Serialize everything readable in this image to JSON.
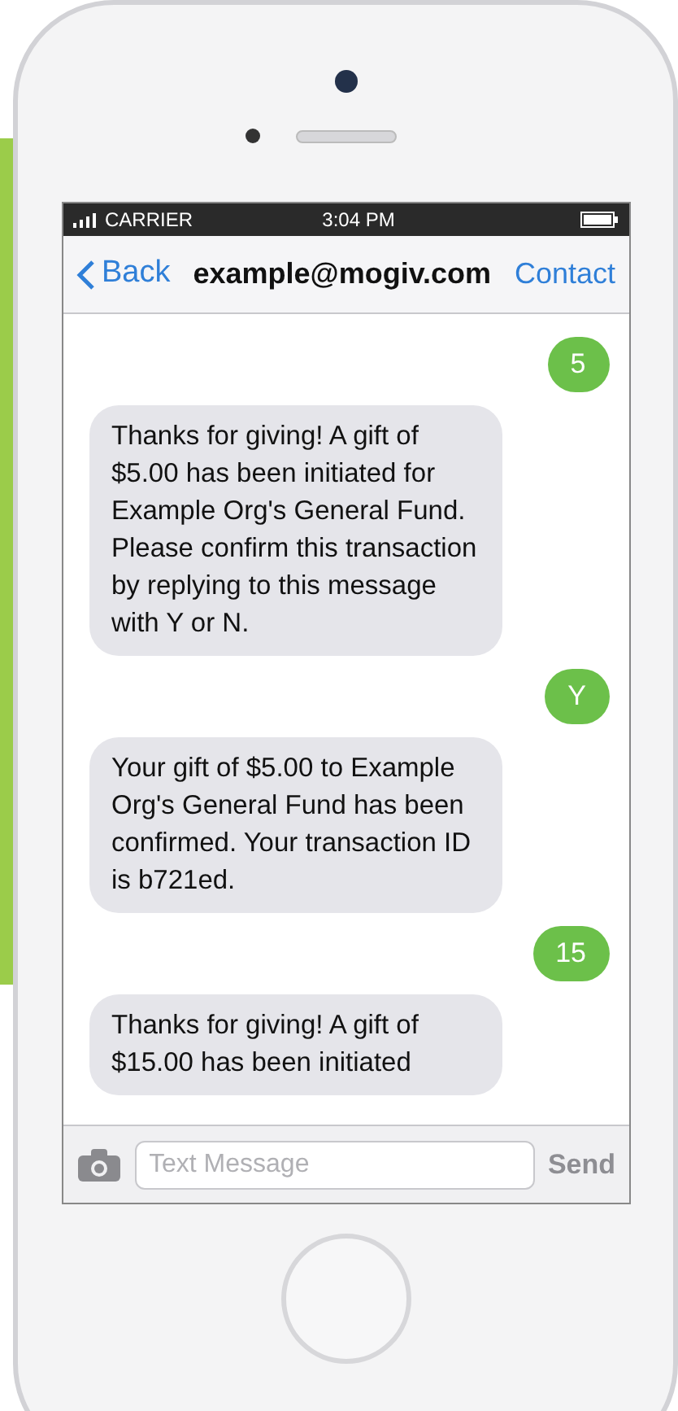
{
  "status_bar": {
    "carrier": "CARRIER",
    "time": "3:04 PM"
  },
  "nav_bar": {
    "back": "Back",
    "title": "example@mogiv.com",
    "action": "Contact"
  },
  "messages": [
    {
      "kind": "sent",
      "text": "5"
    },
    {
      "kind": "received",
      "text": "Thanks for giving! A gift of $5.00 has been initiated for Example Org's General Fund. Please confirm this transaction by replying to this message with Y or N."
    },
    {
      "kind": "sent",
      "text": "Y"
    },
    {
      "kind": "received",
      "text": "Your gift of $5.00 to Example Org's General Fund has been confirmed. Your transaction ID is b721ed."
    },
    {
      "kind": "sent",
      "text": "15"
    },
    {
      "kind": "received",
      "text": "Thanks for giving! A gift of $15.00 has been initiated"
    }
  ],
  "composer": {
    "placeholder": "Text Message",
    "send": "Send",
    "send_disabled": true
  }
}
